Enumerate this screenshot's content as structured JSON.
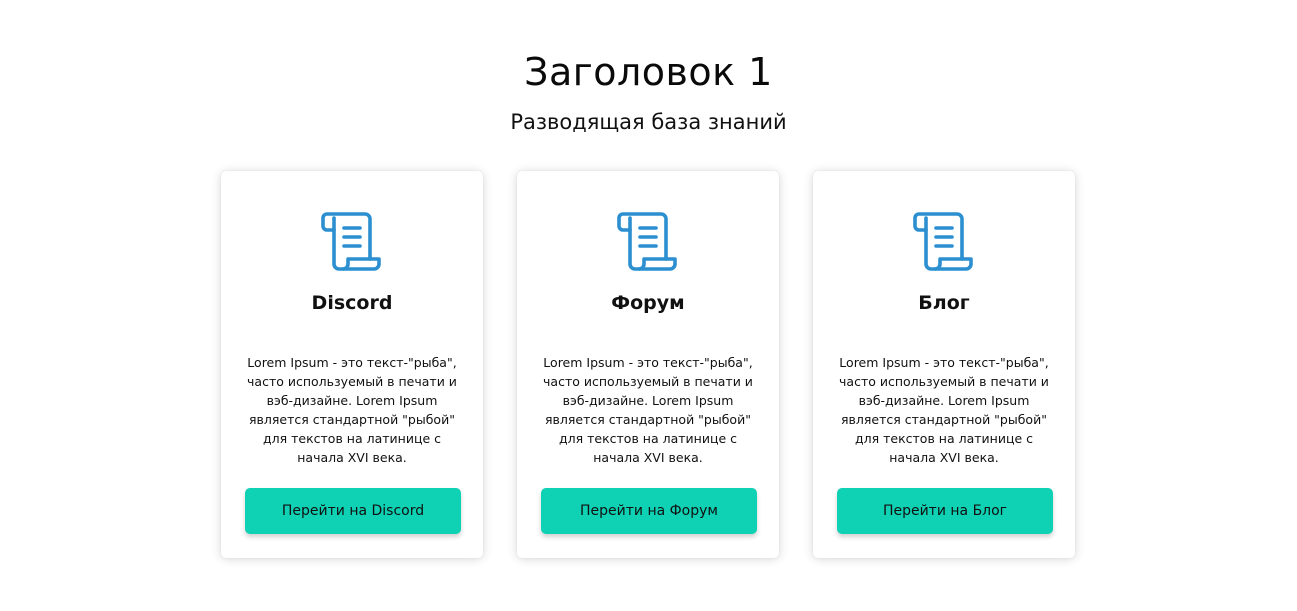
{
  "header": {
    "title": "Заголовок 1",
    "subtitle": "Разводящая база знаний"
  },
  "colors": {
    "accent": "#0fd1b3",
    "icon": "#2b8fd0"
  },
  "cards": [
    {
      "icon": "scroll-document-icon",
      "title": "Discord",
      "text": "Lorem Ipsum - это текст-\"рыба\", часто используемый в печати и вэб-дизайне. Lorem Ipsum является стандартной \"рыбой\" для текстов на латинице с начала XVI века.",
      "button_label": "Перейти на Discord"
    },
    {
      "icon": "scroll-document-icon",
      "title": "Форум",
      "text": "Lorem Ipsum - это текст-\"рыба\", часто используемый в печати и вэб-дизайне. Lorem Ipsum является стандартной \"рыбой\" для текстов на латинице с начала XVI века.",
      "button_label": "Перейти на Форум"
    },
    {
      "icon": "scroll-document-icon",
      "title": "Блог",
      "text": "Lorem Ipsum - это текст-\"рыба\", часто используемый в печати и вэб-дизайне. Lorem Ipsum является стандартной \"рыбой\" для текстов на латинице с начала XVI века.",
      "button_label": "Перейти на Блог"
    }
  ]
}
